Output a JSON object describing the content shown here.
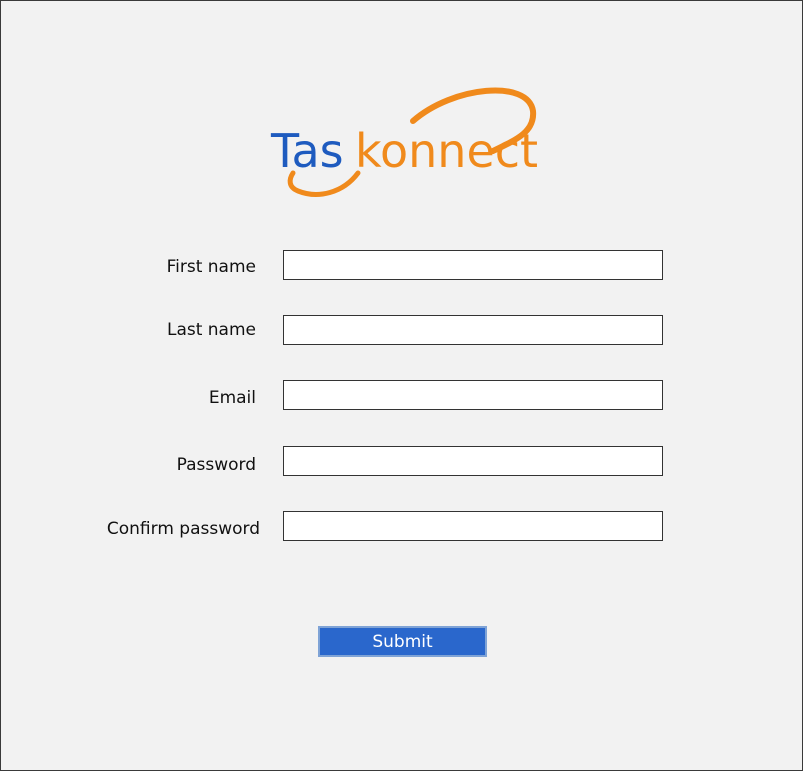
{
  "brand": {
    "name_part1": "Tas",
    "name_part2": "konnect",
    "primary_color": "#1e5bbf",
    "accent_color": "#f08a1c"
  },
  "form": {
    "fields": [
      {
        "label": "First name",
        "value": "",
        "placeholder": ""
      },
      {
        "label": "Last name",
        "value": "",
        "placeholder": ""
      },
      {
        "label": "Email",
        "value": "",
        "placeholder": ""
      },
      {
        "label": "Password",
        "value": "",
        "placeholder": ""
      },
      {
        "label": "Confirm password",
        "value": "",
        "placeholder": ""
      }
    ],
    "submit_label": "Submit",
    "submit_color": "#2a67cc"
  }
}
